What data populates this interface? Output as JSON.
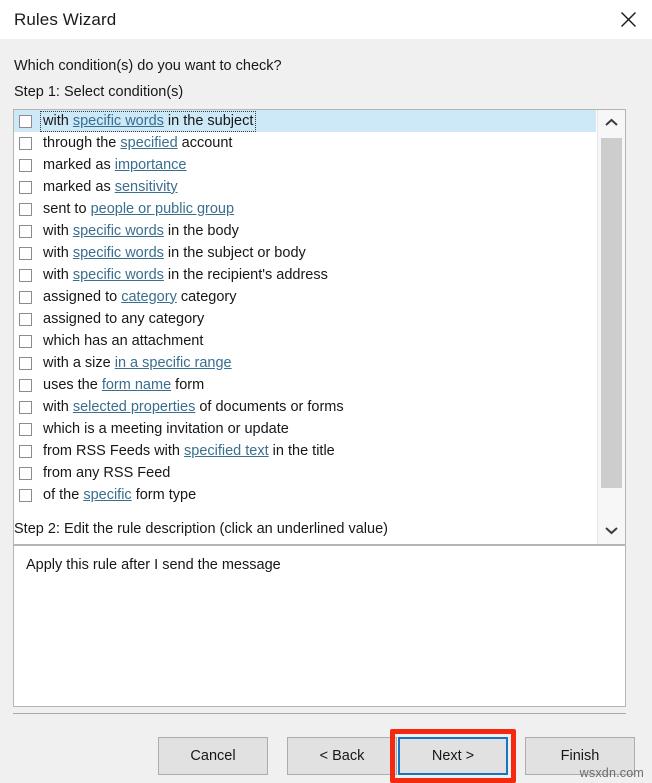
{
  "window": {
    "title": "Rules Wizard",
    "close_icon": "close-icon"
  },
  "main": {
    "prompt": "Which condition(s) do you want to check?",
    "step1_label": "Step 1: Select condition(s)",
    "step2_label": "Step 2: Edit the rule description (click an underlined value)",
    "description_text": "Apply this rule after I send the message"
  },
  "conditions": [
    {
      "selected": true,
      "checked": false,
      "parts": [
        {
          "t": "with ",
          "link": false
        },
        {
          "t": "specific words",
          "link": true
        },
        {
          "t": " in the subject",
          "link": false
        }
      ]
    },
    {
      "selected": false,
      "checked": false,
      "parts": [
        {
          "t": "through the ",
          "link": false
        },
        {
          "t": "specified",
          "link": true
        },
        {
          "t": " account",
          "link": false
        }
      ]
    },
    {
      "selected": false,
      "checked": false,
      "parts": [
        {
          "t": "marked as ",
          "link": false
        },
        {
          "t": "importance",
          "link": true
        }
      ]
    },
    {
      "selected": false,
      "checked": false,
      "parts": [
        {
          "t": "marked as ",
          "link": false
        },
        {
          "t": "sensitivity",
          "link": true
        }
      ]
    },
    {
      "selected": false,
      "checked": false,
      "parts": [
        {
          "t": "sent to ",
          "link": false
        },
        {
          "t": "people or public group",
          "link": true
        }
      ]
    },
    {
      "selected": false,
      "checked": false,
      "parts": [
        {
          "t": "with ",
          "link": false
        },
        {
          "t": "specific words",
          "link": true
        },
        {
          "t": " in the body",
          "link": false
        }
      ]
    },
    {
      "selected": false,
      "checked": false,
      "parts": [
        {
          "t": "with ",
          "link": false
        },
        {
          "t": "specific words",
          "link": true
        },
        {
          "t": " in the subject or body",
          "link": false
        }
      ]
    },
    {
      "selected": false,
      "checked": false,
      "parts": [
        {
          "t": "with ",
          "link": false
        },
        {
          "t": "specific words",
          "link": true
        },
        {
          "t": " in the recipient's address",
          "link": false
        }
      ]
    },
    {
      "selected": false,
      "checked": false,
      "parts": [
        {
          "t": "assigned to ",
          "link": false
        },
        {
          "t": "category",
          "link": true
        },
        {
          "t": " category",
          "link": false
        }
      ]
    },
    {
      "selected": false,
      "checked": false,
      "parts": [
        {
          "t": "assigned to any category",
          "link": false
        }
      ]
    },
    {
      "selected": false,
      "checked": false,
      "parts": [
        {
          "t": "which has an attachment",
          "link": false
        }
      ]
    },
    {
      "selected": false,
      "checked": false,
      "parts": [
        {
          "t": "with a size ",
          "link": false
        },
        {
          "t": "in a specific range",
          "link": true
        }
      ]
    },
    {
      "selected": false,
      "checked": false,
      "parts": [
        {
          "t": "uses the ",
          "link": false
        },
        {
          "t": "form name",
          "link": true
        },
        {
          "t": " form",
          "link": false
        }
      ]
    },
    {
      "selected": false,
      "checked": false,
      "parts": [
        {
          "t": "with ",
          "link": false
        },
        {
          "t": "selected properties",
          "link": true
        },
        {
          "t": " of documents or forms",
          "link": false
        }
      ]
    },
    {
      "selected": false,
      "checked": false,
      "parts": [
        {
          "t": "which is a meeting invitation or update",
          "link": false
        }
      ]
    },
    {
      "selected": false,
      "checked": false,
      "parts": [
        {
          "t": "from RSS Feeds with ",
          "link": false
        },
        {
          "t": "specified text",
          "link": true
        },
        {
          "t": " in the title",
          "link": false
        }
      ]
    },
    {
      "selected": false,
      "checked": false,
      "parts": [
        {
          "t": "from any RSS Feed",
          "link": false
        }
      ]
    },
    {
      "selected": false,
      "checked": false,
      "parts": [
        {
          "t": "of the ",
          "link": false
        },
        {
          "t": "specific",
          "link": true
        },
        {
          "t": " form type",
          "link": false
        }
      ]
    }
  ],
  "scrollbar": {
    "up_icon": "chevron-up-icon",
    "down_icon": "chevron-down-icon"
  },
  "footer": {
    "cancel_label": "Cancel",
    "back_label": "< Back",
    "next_label": "Next >",
    "finish_label": "Finish"
  },
  "watermark": "wsxdn.com",
  "colors": {
    "selection": "#cde8f7",
    "link": "#3a6e8f",
    "focus_border": "#1775c4",
    "highlight_box": "#f32a10",
    "dialog_bg": "#f0f0f0",
    "field_bg": "#ffffff"
  }
}
